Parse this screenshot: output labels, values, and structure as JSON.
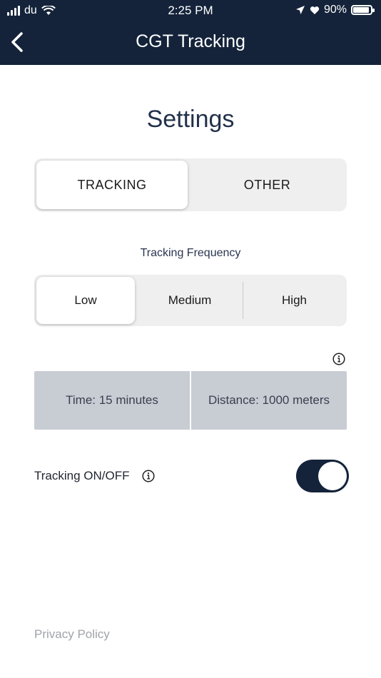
{
  "status_bar": {
    "carrier": "du",
    "time": "2:25 PM",
    "battery_percent": "90%",
    "battery_level": 0.9
  },
  "header": {
    "title": "CGT Tracking",
    "back_icon": "chevron-left-icon",
    "background_color": "#14233a"
  },
  "page": {
    "title": "Settings"
  },
  "main_tabs": {
    "items": [
      {
        "label": "TRACKING",
        "active": true
      },
      {
        "label": "OTHER",
        "active": false
      }
    ]
  },
  "frequency": {
    "label": "Tracking Frequency",
    "options": [
      {
        "label": "Low",
        "selected": true
      },
      {
        "label": "Medium",
        "selected": false
      },
      {
        "label": "High",
        "selected": false
      }
    ]
  },
  "interval_info": {
    "time": "Time: 15 minutes",
    "distance": "Distance: 1000 meters",
    "icon": "info-icon"
  },
  "tracking_toggle": {
    "label": "Tracking ON/OFF",
    "on": true,
    "icon": "info-icon",
    "color": "#14233a"
  },
  "footer": {
    "privacy_link": "Privacy Policy"
  }
}
